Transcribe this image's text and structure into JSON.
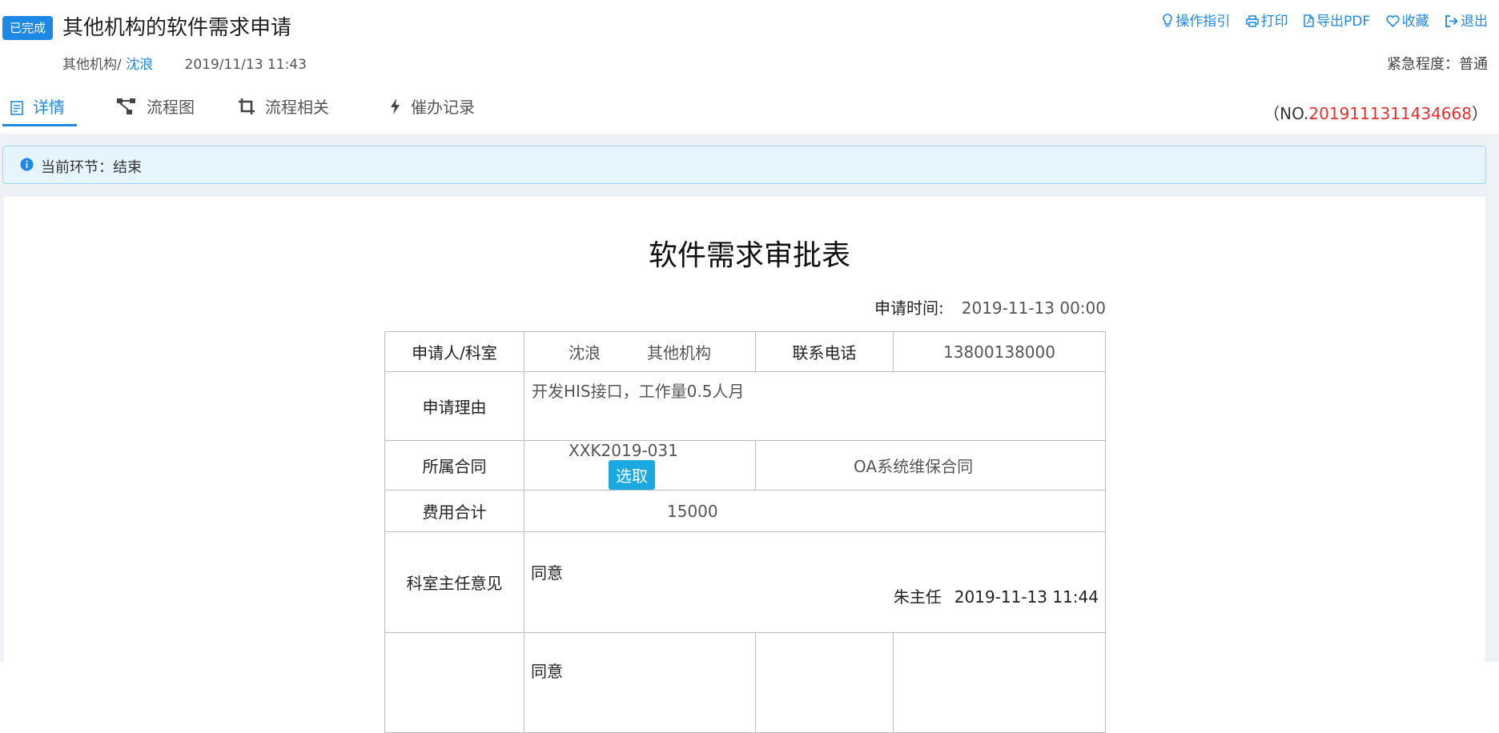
{
  "header": {
    "status_badge": "已完成",
    "title": "其他机构的软件需求申请",
    "org": "其他机构/",
    "user": "沈浪",
    "created": "2019/11/13 11:43",
    "urgency_label": "紧急程度：",
    "urgency_value": "普通"
  },
  "toolbar": {
    "guide": "操作指引",
    "print": "打印",
    "export_pdf": "导出PDF",
    "favorite": "收藏",
    "exit": "退出"
  },
  "tabs": [
    "详情",
    "流程图",
    "流程相关",
    "催办记录"
  ],
  "doc_number": {
    "prefix": "（NO.",
    "number": "201911131143466",
    "checksum": "8",
    "suffix": "）"
  },
  "alert": {
    "text": "当前环节：结束"
  },
  "form": {
    "title": "软件需求审批表",
    "apply_time_label": "申请时间:",
    "apply_time_value": "2019-11-13 00:00",
    "applicant_label": "申请人/科室",
    "applicant_name": "沈浪",
    "applicant_dept": "其他机构",
    "phone_label": "联系电话",
    "phone_value": "13800138000",
    "reason_label": "申请理由",
    "reason_value": "开发HIS接口，工作量0.5人月",
    "contract_label": "所属合同",
    "contract_no": "XXK2019-031",
    "pick_button": "选取",
    "contract_name": "OA系统维保合同",
    "cost_label": "费用合计",
    "cost_value": "15000",
    "director_label": "科室主任意见",
    "director_opinion": "同意",
    "director_signer": "朱主任",
    "director_date": "2019-11-13 11:44",
    "next_opinion": "同意"
  },
  "colors": {
    "accent": "#1e88e5",
    "danger": "#f02b2b",
    "info_bg": "#e6f5fd",
    "page_bg": "#eef1f6"
  }
}
